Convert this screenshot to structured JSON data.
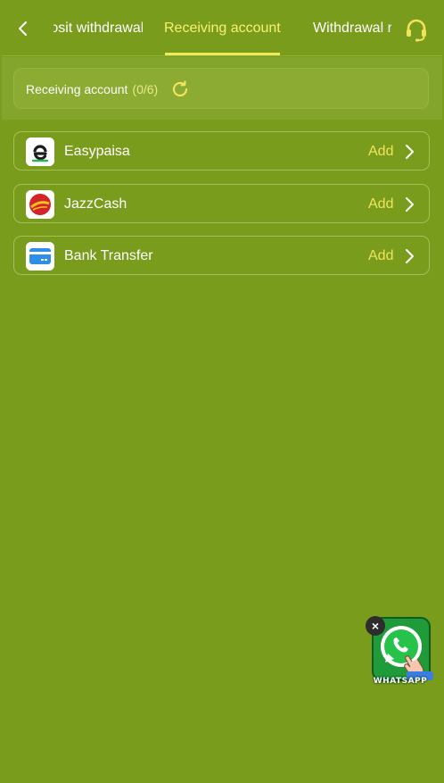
{
  "header": {
    "tabs": [
      {
        "label": "Deposit withdrawal",
        "active": false
      },
      {
        "label": "Receiving account",
        "active": true
      },
      {
        "label": "Withdrawal record",
        "active": false
      }
    ]
  },
  "info": {
    "label": "Receiving account",
    "count": "(0/6)"
  },
  "accounts": [
    {
      "name": "Easypaisa",
      "action": "Add",
      "icon": "easypaisa-logo-icon"
    },
    {
      "name": "JazzCash",
      "action": "Add",
      "icon": "jazzcash-logo-icon"
    },
    {
      "name": "Bank Transfer",
      "action": "Add",
      "icon": "bank-card-icon"
    }
  ],
  "whatsapp": {
    "label": "WHATSAPP"
  },
  "colors": {
    "background": "#7a9c1d",
    "accent": "#f1e45b",
    "active_tab": "#f7f170"
  }
}
